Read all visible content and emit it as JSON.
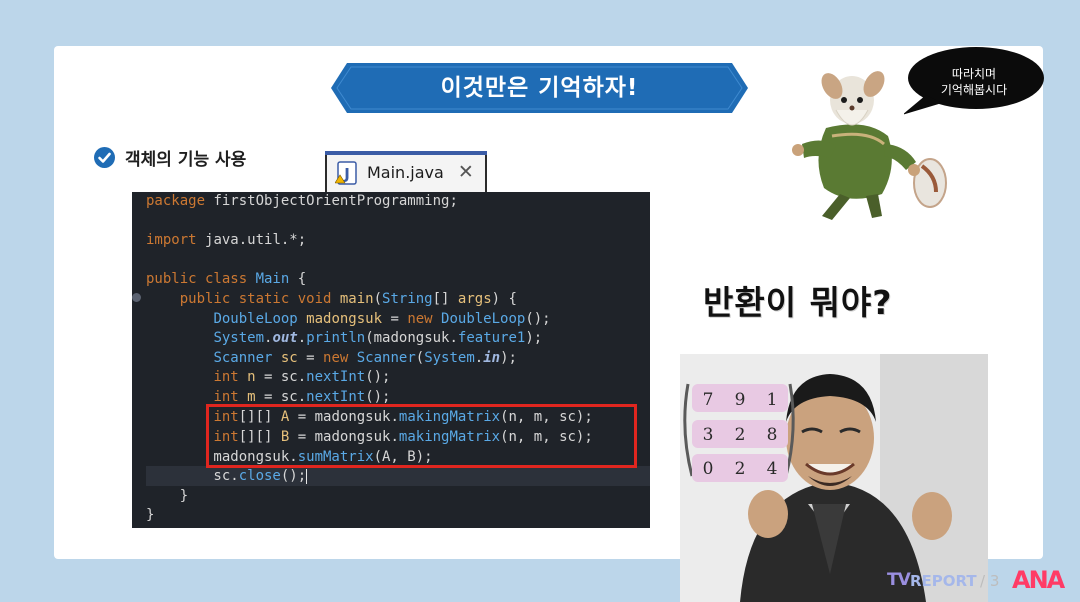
{
  "slide": {
    "banner_title": "이것만은 기억하자!",
    "bullet_label": "객체의 기능 사용",
    "question_text": "반환이 뭐야?",
    "bubble_lines": [
      "따라치며",
      "기억해봅시다"
    ]
  },
  "editor": {
    "tab_label": "Main.java",
    "tab_icon": "java-file-icon",
    "close_icon": "close-icon",
    "code_lines": [
      "package firstObjectOrientProgramming;",
      "",
      "import java.util.*;",
      "",
      "public class Main {",
      "    public static void main(String[] args) {",
      "        DoubleLoop madongsuk = new DoubleLoop();",
      "        System.out.println(madongsuk.feature1);",
      "        Scanner sc = new Scanner(System.in);",
      "        int n = sc.nextInt();",
      "        int m = sc.nextInt();",
      "        int[][] A = madongsuk.makingMatrix(n, m, sc);",
      "        int[][] B = madongsuk.makingMatrix(n, m, sc);",
      "        madongsuk.sumMatrix(A, B);",
      "        sc.close();",
      "    }",
      "}"
    ],
    "highlighted_lines": [
      11,
      13
    ]
  },
  "matrix": {
    "rows": [
      [
        "7",
        "9",
        "1"
      ],
      [
        "3",
        "2",
        "8"
      ],
      [
        "0",
        "2",
        "4"
      ]
    ]
  },
  "watermark": {
    "tv": "TV",
    "report": "REPORT",
    "faint": "/ 3",
    "ana": "ANA"
  },
  "colors": {
    "background": "#bcd6ea",
    "banner": "#1f6cb5",
    "highlight": "#e0261f",
    "editor_bg": "#1f2329"
  }
}
